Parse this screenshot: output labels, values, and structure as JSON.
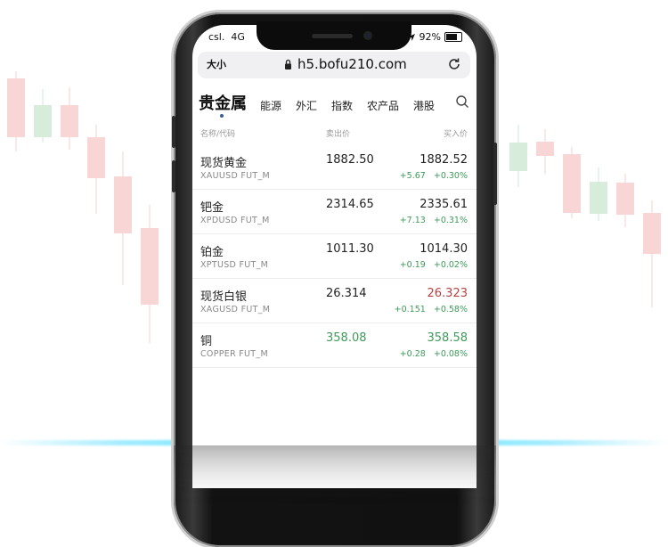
{
  "status_bar": {
    "carrier": "csl.",
    "network": "4G",
    "battery": "92%"
  },
  "browser": {
    "text_size": "大小",
    "url": "h5.bofu210.com"
  },
  "tabs": [
    {
      "label": "贵金属",
      "active": true
    },
    {
      "label": "能源"
    },
    {
      "label": "外汇"
    },
    {
      "label": "指数"
    },
    {
      "label": "农产品"
    },
    {
      "label": "港股"
    }
  ],
  "columns": {
    "name": "名称/代码",
    "sell": "卖出价",
    "buy": "买入价"
  },
  "rows": [
    {
      "name": "现货黄金",
      "code": "XAUUSD  FUT_M",
      "sell": "1882.50",
      "buy": "1882.52",
      "change": "+5.67   +0.30%"
    },
    {
      "name": "钯金",
      "code": "XPDUSD  FUT_M",
      "sell": "2314.65",
      "buy": "2335.61",
      "change": "+7.13   +0.31%"
    },
    {
      "name": "铂金",
      "code": "XPTUSD  FUT_M",
      "sell": "1011.30",
      "buy": "1014.30",
      "change": "+0.19   +0.02%"
    },
    {
      "name": "现货白银",
      "code": "XAGUSD  FUT_M",
      "sell": "26.314",
      "buy": "26.323",
      "change": "+0.151   +0.58%"
    },
    {
      "name": "铜",
      "code": "COPPER  FUT_M",
      "sell": "358.08",
      "buy": "358.58",
      "change": "+0.28   +0.08%"
    }
  ],
  "colors": {
    "up": "#3e9a5a",
    "down": "#b84040",
    "accent": "#6fe6ff"
  },
  "icons": [
    "lock-icon",
    "reload-icon",
    "search-icon",
    "location-icon",
    "battery-icon"
  ]
}
